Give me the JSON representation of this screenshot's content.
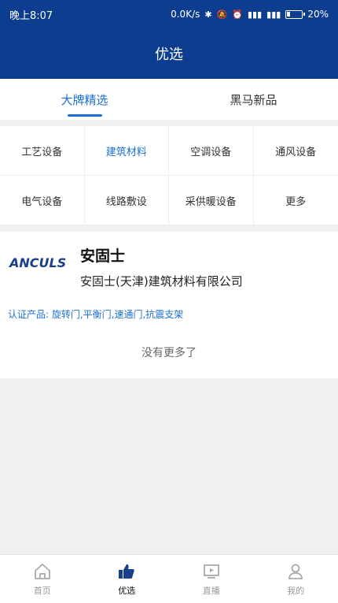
{
  "status_bar": {
    "time": "晚上8:07",
    "network_speed": "0.0K/s",
    "battery": "20%"
  },
  "header": {
    "title": "优选"
  },
  "tabs": [
    {
      "label": "大牌精选",
      "active": true
    },
    {
      "label": "黑马新品",
      "active": false
    }
  ],
  "categories": [
    {
      "label": "工艺设备",
      "active": false
    },
    {
      "label": "建筑材料",
      "active": true
    },
    {
      "label": "空调设备",
      "active": false
    },
    {
      "label": "通风设备",
      "active": false
    },
    {
      "label": "电气设备",
      "active": false
    },
    {
      "label": "线路敷设",
      "active": false
    },
    {
      "label": "采供暖设备",
      "active": false
    },
    {
      "label": "更多",
      "active": false
    }
  ],
  "brand": {
    "logo_text": "ANCULS",
    "name": "安固士",
    "company": "安固士(天津)建筑材料有限公司",
    "certified_products": "认证产品: 旋转门,平衡门,速通门,抗震支架"
  },
  "list_end": {
    "text": "没有更多了"
  },
  "bottom_nav": [
    {
      "label": "首页",
      "icon": "home-icon",
      "active": false
    },
    {
      "label": "优选",
      "icon": "thumbs-up-icon",
      "active": true
    },
    {
      "label": "直播",
      "icon": "live-play-icon",
      "active": false
    },
    {
      "label": "我的",
      "icon": "profile-icon",
      "active": false
    }
  ],
  "colors": {
    "primary": "#0c3d8e",
    "accent": "#1a6fd1"
  }
}
